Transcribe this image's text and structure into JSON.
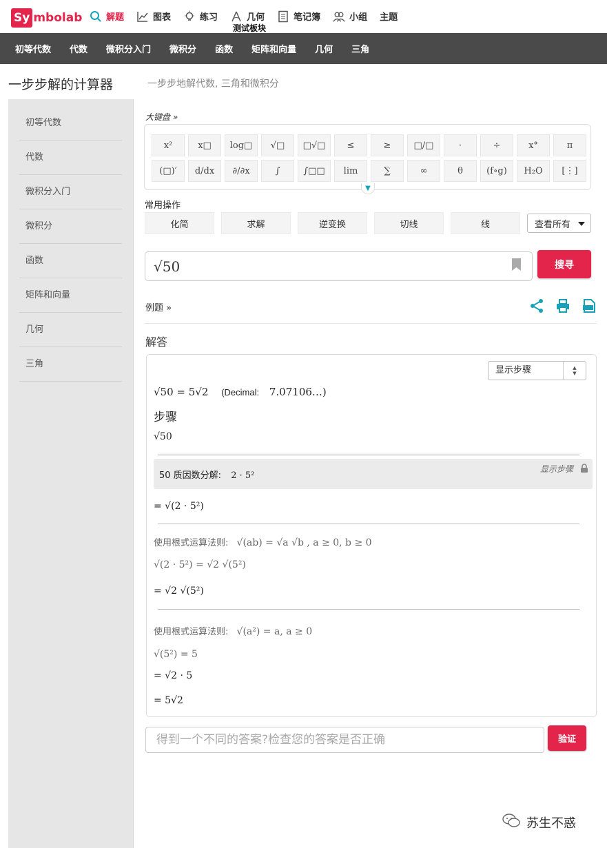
{
  "brand": {
    "logo_box": "Sy",
    "logo_rest": "mbolab"
  },
  "topnav": [
    {
      "label": "解题",
      "icon": "search-icon",
      "active": true
    },
    {
      "label": "图表",
      "icon": "chart-icon"
    },
    {
      "label": "练习",
      "icon": "lightbulb-icon"
    },
    {
      "label": "几何",
      "icon": "compass-icon"
    },
    {
      "label": "笔记簿",
      "icon": "notebook-icon"
    },
    {
      "label": "小组",
      "icon": "group-icon"
    },
    {
      "label": "主题",
      "icon": ""
    }
  ],
  "tooltip": "测试板块",
  "subnav": [
    "初等代数",
    "代数",
    "微积分入门",
    "微积分",
    "函数",
    "矩阵和向量",
    "几何",
    "三角"
  ],
  "header": {
    "title": "一步步解的计算器",
    "subtitle": "一步步地解代数, 三角和微积分"
  },
  "sidebar": [
    "初等代数",
    "代数",
    "微积分入门",
    "微积分",
    "函数",
    "矩阵和向量",
    "几何",
    "三角"
  ],
  "keyboard": {
    "title": "大键盘 »",
    "row1": [
      "x²",
      "x□",
      "log□",
      "√□",
      "□√□",
      "≤",
      "≥",
      "□/□",
      "·",
      "÷",
      "x°",
      "π"
    ],
    "row2": [
      "(□)′",
      "d/dx",
      "∂/∂x",
      "∫",
      "∫□□",
      "lim",
      "∑",
      "∞",
      "θ",
      "(f∘g)",
      "H₂O",
      "[⋮]"
    ]
  },
  "ops": {
    "title": "常用操作",
    "items": [
      "化简",
      "求解",
      "逆变换",
      "切线",
      "线"
    ],
    "view_all": "查看所有"
  },
  "search": {
    "expression": "√50",
    "button": "搜寻"
  },
  "examples": "例题 »",
  "answer_title": "解答",
  "panel": {
    "steps_select": "显示步骤",
    "result": "√50 = 5√2",
    "decimal_label": "(Decimal:",
    "decimal_value": "7.07106…)",
    "steps_heading": "步骤",
    "step_start": "√50",
    "prime_label": "50 质因数分解:",
    "prime_value": "2 · 5²",
    "show_steps": "显示步骤",
    "line1": "= √(2 · 5²)",
    "rule1_label": "使用根式运算法则:",
    "rule1_formula": "√(ab) = √a √b ,     a ≥ 0, b ≥ 0",
    "line2": "√(2 · 5²) = √2 √(5²)",
    "line3": "= √2 √(5²)",
    "rule2_label": "使用根式运算法则:",
    "rule2_formula": "√(a²) = a,     a ≥ 0",
    "line4": "√(5²) = 5",
    "line5": "= √2 · 5",
    "line6": "= 5√2"
  },
  "feedback": {
    "placeholder": "得到一个不同的答案?检查您的答案是否正确",
    "button": "验证"
  },
  "watermark": "苏生不惑",
  "colors": {
    "brand": "#e3254b",
    "subnav_bg": "#4a4a4a",
    "sidebar_bg": "#e6e6e6",
    "teal": "#18a2b8"
  }
}
